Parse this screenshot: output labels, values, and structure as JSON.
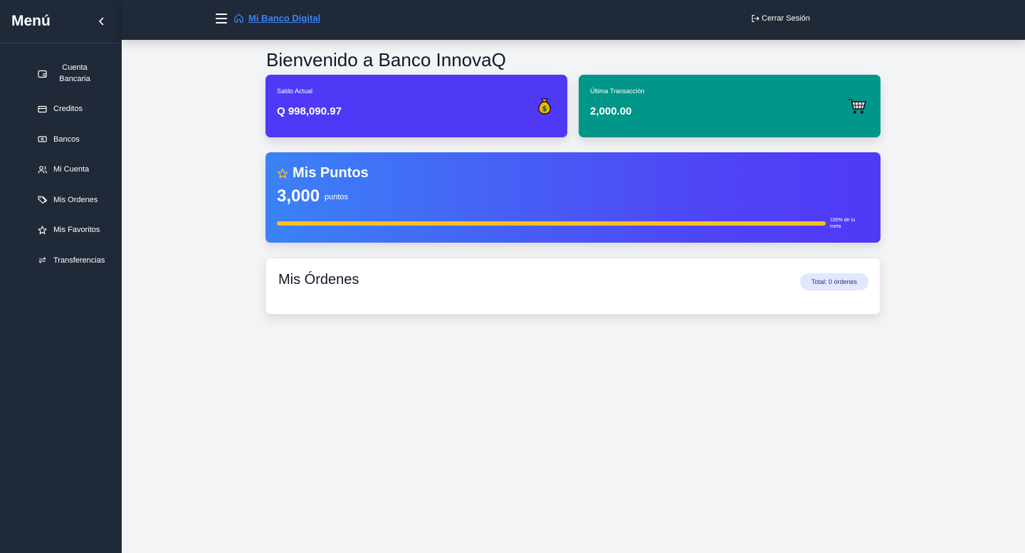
{
  "sidebar": {
    "title": "Menú",
    "collapse_icon": "chevron-left-icon",
    "items": [
      {
        "label": "Cuenta Bancaria",
        "icon": "wallet-icon"
      },
      {
        "label": "Creditos",
        "icon": "credit-card-icon"
      },
      {
        "label": "Bancos",
        "icon": "banknote-icon"
      },
      {
        "label": "Mi Cuenta",
        "icon": "users-icon"
      },
      {
        "label": "Mis Ordenes",
        "icon": "tags-icon"
      },
      {
        "label": "Mis Favoritos",
        "icon": "star-icon"
      },
      {
        "label": "Transferencias",
        "icon": "arrows-exchange-icon"
      }
    ]
  },
  "topbar": {
    "brand": "Mi Banco Digital",
    "logout": "Cerrar Sesión"
  },
  "main": {
    "title": "Bienvenido a Banco InnovaQ",
    "balance": {
      "label": "Saldo Actual",
      "value": "Q 998,090.97",
      "icon": "money-bag-icon",
      "color": "#4f39f6"
    },
    "last_transaction": {
      "label": "Última Transacción",
      "value": "2,000.00",
      "icon": "shopping-cart-icon",
      "color": "#009689"
    },
    "points": {
      "title": "Mis Puntos",
      "value": "3,000",
      "unit": "puntos",
      "progress_percent": 100,
      "progress_label": "100% de tu meta",
      "progress_color": "#fbbf24"
    },
    "orders": {
      "title": "Mis Órdenes",
      "badge": "Total: 0 órdenes"
    }
  }
}
